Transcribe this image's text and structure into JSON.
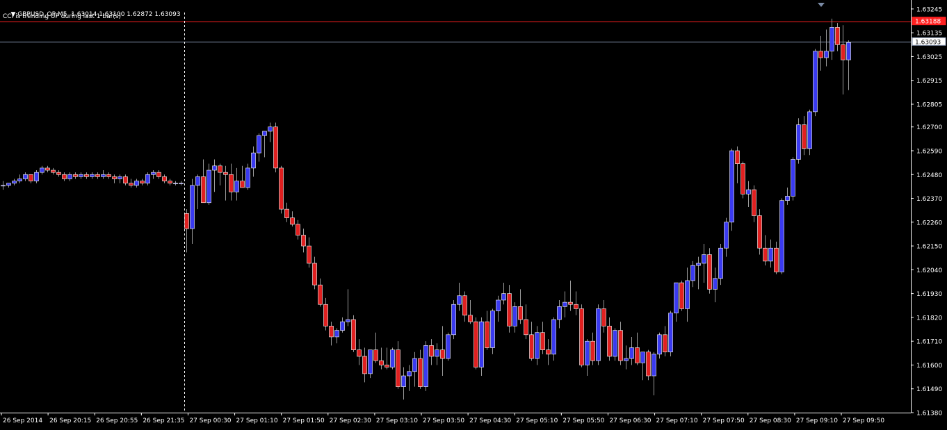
{
  "header": {
    "symbol_line": "GBPUSD_OP,M5  1.63014 1.63100 1.62872 1.63093",
    "indicator_note": "CCI is trending UP during last 1 bar(s)"
  },
  "colors": {
    "background": "#000000",
    "bull_body": "#3a3af0",
    "bear_body": "#e02020",
    "wick": "#9a9a9a",
    "grid_text": "#ffffff",
    "red_line": "#ff2020",
    "bid_line": "#8a9ab5",
    "separator": "#ffffff"
  },
  "chart_data": {
    "type": "candlestick",
    "symbol": "GBPUSD_OP",
    "timeframe": "M5",
    "ohlc": {
      "open": 1.63014,
      "high": 1.631,
      "low": 1.62872,
      "close": 1.63093
    },
    "ylim": [
      1.6138,
      1.6328
    ],
    "yticks": [
      "1.63245",
      "1.63135",
      "1.63025",
      "1.62915",
      "1.62805",
      "1.62700",
      "1.62590",
      "1.62480",
      "1.62370",
      "1.62260",
      "1.62150",
      "1.62040",
      "1.61930",
      "1.61820",
      "1.61710",
      "1.61600",
      "1.61490",
      "1.61380"
    ],
    "xticks": [
      "26 Sep 2014",
      "26 Sep 20:15",
      "26 Sep 20:55",
      "26 Sep 21:35",
      "27 Sep 00:30",
      "27 Sep 01:10",
      "27 Sep 01:50",
      "27 Sep 02:30",
      "27 Sep 03:10",
      "27 Sep 03:50",
      "27 Sep 04:30",
      "27 Sep 05:10",
      "27 Sep 05:50",
      "27 Sep 06:30",
      "27 Sep 07:10",
      "27 Sep 07:50",
      "27 Sep 08:30",
      "27 Sep 09:10",
      "27 Sep 09:50"
    ],
    "hlines": [
      {
        "label": "1.63188",
        "value": 1.63188,
        "role": "red"
      },
      {
        "label": "1.63093",
        "value": 1.63093,
        "role": "bid"
      }
    ],
    "separator_index": 33,
    "candles": [
      [
        1.6243,
        1.6245,
        1.6241,
        1.6243
      ],
      [
        1.6243,
        1.6244,
        1.6242,
        1.6244
      ],
      [
        1.6244,
        1.6246,
        1.6243,
        1.6245
      ],
      [
        1.6245,
        1.6248,
        1.6244,
        1.6246
      ],
      [
        1.6246,
        1.6249,
        1.6245,
        1.6248
      ],
      [
        1.6248,
        1.6248,
        1.6244,
        1.6245
      ],
      [
        1.6245,
        1.625,
        1.6244,
        1.6249
      ],
      [
        1.6249,
        1.6252,
        1.6248,
        1.6251
      ],
      [
        1.6251,
        1.6252,
        1.6249,
        1.625
      ],
      [
        1.625,
        1.6251,
        1.6248,
        1.6249
      ],
      [
        1.6249,
        1.625,
        1.6247,
        1.6248
      ],
      [
        1.6248,
        1.6249,
        1.6245,
        1.6246
      ],
      [
        1.6246,
        1.6249,
        1.6245,
        1.6248
      ],
      [
        1.6248,
        1.6249,
        1.6246,
        1.6247
      ],
      [
        1.6247,
        1.6249,
        1.6246,
        1.6248
      ],
      [
        1.6248,
        1.6249,
        1.6246,
        1.6247
      ],
      [
        1.6247,
        1.6249,
        1.6246,
        1.6248
      ],
      [
        1.6248,
        1.6249,
        1.6246,
        1.6247
      ],
      [
        1.6247,
        1.625,
        1.6246,
        1.6248
      ],
      [
        1.6248,
        1.6249,
        1.6246,
        1.6247
      ],
      [
        1.6247,
        1.6248,
        1.6244,
        1.6246
      ],
      [
        1.6246,
        1.6248,
        1.6244,
        1.6247
      ],
      [
        1.6247,
        1.6248,
        1.6243,
        1.6244
      ],
      [
        1.6244,
        1.6246,
        1.6242,
        1.6243
      ],
      [
        1.6243,
        1.6246,
        1.6242,
        1.6245
      ],
      [
        1.6245,
        1.6246,
        1.6243,
        1.6244
      ],
      [
        1.6244,
        1.6249,
        1.6243,
        1.6248
      ],
      [
        1.6248,
        1.625,
        1.6246,
        1.6249
      ],
      [
        1.6249,
        1.625,
        1.6246,
        1.6247
      ],
      [
        1.6247,
        1.6248,
        1.6244,
        1.6245
      ],
      [
        1.6245,
        1.6246,
        1.6243,
        1.6244
      ],
      [
        1.6244,
        1.6245,
        1.6243,
        1.6244
      ],
      [
        1.6244,
        1.6245,
        1.6243,
        1.6244
      ],
      [
        1.623,
        1.6232,
        1.6212,
        1.6223
      ],
      [
        1.6223,
        1.6246,
        1.6216,
        1.6243
      ],
      [
        1.6243,
        1.6248,
        1.6232,
        1.6247
      ],
      [
        1.6247,
        1.6255,
        1.6236,
        1.6235
      ],
      [
        1.6235,
        1.6253,
        1.6234,
        1.625
      ],
      [
        1.625,
        1.6255,
        1.624,
        1.6252
      ],
      [
        1.6252,
        1.6253,
        1.6243,
        1.6249
      ],
      [
        1.6249,
        1.6252,
        1.6236,
        1.6248
      ],
      [
        1.6248,
        1.6253,
        1.6236,
        1.624
      ],
      [
        1.624,
        1.6251,
        1.6236,
        1.6245
      ],
      [
        1.6245,
        1.6252,
        1.6242,
        1.6242
      ],
      [
        1.6242,
        1.6253,
        1.6241,
        1.6251
      ],
      [
        1.6251,
        1.6261,
        1.6247,
        1.6258
      ],
      [
        1.6258,
        1.6267,
        1.6254,
        1.6266
      ],
      [
        1.6266,
        1.6268,
        1.6256,
        1.6268
      ],
      [
        1.6268,
        1.6272,
        1.6263,
        1.627
      ],
      [
        1.627,
        1.6272,
        1.6249,
        1.6251
      ],
      [
        1.6251,
        1.6252,
        1.623,
        1.6232
      ],
      [
        1.6232,
        1.6235,
        1.6226,
        1.6228
      ],
      [
        1.6228,
        1.6231,
        1.6224,
        1.6225
      ],
      [
        1.6225,
        1.6227,
        1.6218,
        1.622
      ],
      [
        1.622,
        1.6223,
        1.6212,
        1.6215
      ],
      [
        1.6215,
        1.6219,
        1.6205,
        1.6207
      ],
      [
        1.6207,
        1.621,
        1.6195,
        1.6197
      ],
      [
        1.6197,
        1.62,
        1.6187,
        1.6188
      ],
      [
        1.6188,
        1.6191,
        1.6176,
        1.6178
      ],
      [
        1.6178,
        1.618,
        1.6169,
        1.6173
      ],
      [
        1.6173,
        1.6177,
        1.617,
        1.6176
      ],
      [
        1.6176,
        1.6182,
        1.6175,
        1.618
      ],
      [
        1.618,
        1.6195,
        1.6178,
        1.6181
      ],
      [
        1.6181,
        1.6183,
        1.6166,
        1.6167
      ],
      [
        1.6167,
        1.6172,
        1.616,
        1.6164
      ],
      [
        1.6164,
        1.6168,
        1.6152,
        1.6156
      ],
      [
        1.6156,
        1.6167,
        1.6154,
        1.6167
      ],
      [
        1.6167,
        1.6175,
        1.6161,
        1.6162
      ],
      [
        1.6162,
        1.6168,
        1.6158,
        1.616
      ],
      [
        1.616,
        1.6168,
        1.6158,
        1.6159
      ],
      [
        1.6159,
        1.6168,
        1.6158,
        1.6167
      ],
      [
        1.6167,
        1.6171,
        1.6149,
        1.615
      ],
      [
        1.615,
        1.6159,
        1.6144,
        1.6155
      ],
      [
        1.6155,
        1.616,
        1.6148,
        1.6157
      ],
      [
        1.6157,
        1.6166,
        1.615,
        1.6163
      ],
      [
        1.6163,
        1.6167,
        1.6149,
        1.615
      ],
      [
        1.615,
        1.6171,
        1.6148,
        1.6169
      ],
      [
        1.6169,
        1.6172,
        1.616,
        1.6164
      ],
      [
        1.6164,
        1.617,
        1.616,
        1.6167
      ],
      [
        1.6167,
        1.6178,
        1.6155,
        1.6163
      ],
      [
        1.6163,
        1.6175,
        1.6162,
        1.6174
      ],
      [
        1.6174,
        1.619,
        1.6172,
        1.6188
      ],
      [
        1.6188,
        1.6198,
        1.6185,
        1.6192
      ],
      [
        1.6192,
        1.6194,
        1.618,
        1.6183
      ],
      [
        1.6183,
        1.619,
        1.6179,
        1.618
      ],
      [
        1.618,
        1.6182,
        1.6158,
        1.6159
      ],
      [
        1.6159,
        1.6182,
        1.6155,
        1.618
      ],
      [
        1.618,
        1.6185,
        1.6167,
        1.6168
      ],
      [
        1.6168,
        1.6186,
        1.6165,
        1.6185
      ],
      [
        1.6185,
        1.6192,
        1.618,
        1.619
      ],
      [
        1.619,
        1.6198,
        1.6188,
        1.6193
      ],
      [
        1.6193,
        1.6197,
        1.6175,
        1.6178
      ],
      [
        1.6178,
        1.6189,
        1.6175,
        1.6187
      ],
      [
        1.6187,
        1.6195,
        1.6179,
        1.6181
      ],
      [
        1.6181,
        1.6188,
        1.6172,
        1.6174
      ],
      [
        1.6174,
        1.618,
        1.6162,
        1.6163
      ],
      [
        1.6163,
        1.6178,
        1.616,
        1.6175
      ],
      [
        1.6175,
        1.618,
        1.6165,
        1.6167
      ],
      [
        1.6167,
        1.6172,
        1.616,
        1.6165
      ],
      [
        1.6165,
        1.6182,
        1.6162,
        1.6181
      ],
      [
        1.6181,
        1.619,
        1.6177,
        1.6187
      ],
      [
        1.6187,
        1.6194,
        1.6182,
        1.6189
      ],
      [
        1.6189,
        1.6199,
        1.6185,
        1.6188
      ],
      [
        1.6188,
        1.6194,
        1.6183,
        1.6186
      ],
      [
        1.6186,
        1.6188,
        1.6159,
        1.616
      ],
      [
        1.616,
        1.6172,
        1.6155,
        1.6171
      ],
      [
        1.6171,
        1.6175,
        1.616,
        1.6162
      ],
      [
        1.6162,
        1.6188,
        1.616,
        1.6186
      ],
      [
        1.6186,
        1.619,
        1.6175,
        1.6178
      ],
      [
        1.6178,
        1.6182,
        1.6162,
        1.6164
      ],
      [
        1.6164,
        1.6177,
        1.6162,
        1.6176
      ],
      [
        1.6176,
        1.618,
        1.616,
        1.6162
      ],
      [
        1.6162,
        1.6169,
        1.6158,
        1.6163
      ],
      [
        1.6163,
        1.6173,
        1.616,
        1.6168
      ],
      [
        1.6168,
        1.6175,
        1.616,
        1.6161
      ],
      [
        1.6161,
        1.6166,
        1.6153,
        1.6166
      ],
      [
        1.6166,
        1.6167,
        1.6153,
        1.6155
      ],
      [
        1.6155,
        1.6166,
        1.6146,
        1.6165
      ],
      [
        1.6165,
        1.6175,
        1.6163,
        1.6174
      ],
      [
        1.6174,
        1.6178,
        1.6164,
        1.6166
      ],
      [
        1.6166,
        1.6185,
        1.6164,
        1.6184
      ],
      [
        1.6184,
        1.6198,
        1.618,
        1.6198
      ],
      [
        1.6198,
        1.6199,
        1.6185,
        1.6186
      ],
      [
        1.6186,
        1.6205,
        1.618,
        1.6199
      ],
      [
        1.6199,
        1.6208,
        1.6196,
        1.6206
      ],
      [
        1.6206,
        1.621,
        1.6195,
        1.6207
      ],
      [
        1.6207,
        1.6216,
        1.6198,
        1.6211
      ],
      [
        1.6211,
        1.6214,
        1.6193,
        1.6195
      ],
      [
        1.6195,
        1.6205,
        1.6189,
        1.62
      ],
      [
        1.62,
        1.6216,
        1.6197,
        1.6214
      ],
      [
        1.6214,
        1.6228,
        1.621,
        1.6226
      ],
      [
        1.6226,
        1.626,
        1.6222,
        1.6259
      ],
      [
        1.6259,
        1.6261,
        1.6244,
        1.6253
      ],
      [
        1.6253,
        1.6254,
        1.6237,
        1.6239
      ],
      [
        1.6239,
        1.6245,
        1.6233,
        1.6241
      ],
      [
        1.6241,
        1.6243,
        1.6226,
        1.6229
      ],
      [
        1.6229,
        1.6232,
        1.6211,
        1.6214
      ],
      [
        1.6214,
        1.622,
        1.6206,
        1.6208
      ],
      [
        1.6208,
        1.6218,
        1.6205,
        1.6214
      ],
      [
        1.6214,
        1.6217,
        1.6202,
        1.6203
      ],
      [
        1.6203,
        1.6237,
        1.6202,
        1.6236
      ],
      [
        1.6236,
        1.6242,
        1.6234,
        1.6238
      ],
      [
        1.6238,
        1.6256,
        1.6236,
        1.6255
      ],
      [
        1.6255,
        1.6274,
        1.6253,
        1.6271
      ],
      [
        1.6271,
        1.6275,
        1.6257,
        1.626
      ],
      [
        1.626,
        1.6278,
        1.6257,
        1.6277
      ],
      [
        1.6277,
        1.6306,
        1.6275,
        1.6305
      ],
      [
        1.6305,
        1.6312,
        1.6296,
        1.6302
      ],
      [
        1.6302,
        1.6315,
        1.6298,
        1.6305
      ],
      [
        1.6305,
        1.632,
        1.6301,
        1.6316
      ],
      [
        1.6316,
        1.6318,
        1.6305,
        1.6308
      ],
      [
        1.6308,
        1.6317,
        1.6285,
        1.6301
      ],
      [
        1.6301,
        1.631,
        1.6287,
        1.6309
      ]
    ]
  }
}
